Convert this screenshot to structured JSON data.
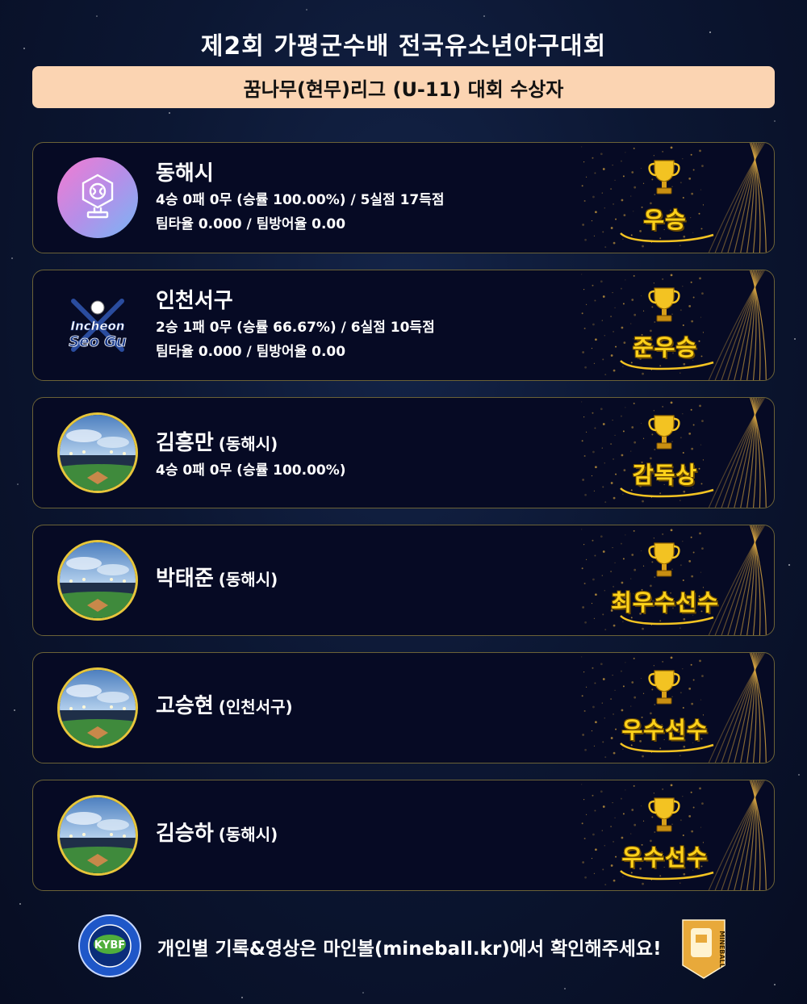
{
  "header": {
    "title": "제2회 가평군수배 전국유소년야구대회",
    "subtitle": "꿈나무(현무)리그 (U-11) 대회 수상자"
  },
  "colors": {
    "accent": "#ffd21a",
    "subtitle_bg": "#fbd4b2",
    "card_bg": "#060a24",
    "card_border": "#6b6237"
  },
  "awards": [
    {
      "name": "동해시",
      "team": "",
      "line1": "4승 0패 0무 (승률 100.00%) / 5실점 17득점",
      "line2": "팀타율 0.000 / 팀방어율 0.00",
      "award": "우승",
      "avatar": "trophy-icon"
    },
    {
      "name": "인천서구",
      "team": "",
      "line1": "2승 1패 0무 (승률 66.67%) / 6실점 10득점",
      "line2": "팀타율 0.000 / 팀방어율 0.00",
      "award": "준우승",
      "avatar": "team-logo",
      "logo_text1": "Incheon",
      "logo_text2": "Seo Gu"
    },
    {
      "name": "김흥만",
      "team": "(동해시)",
      "line1": "4승 0패 0무 (승률 100.00%)",
      "line2": "",
      "award": "감독상",
      "avatar": "stadium-photo"
    },
    {
      "name": "박태준",
      "team": "(동해시)",
      "line1": "",
      "line2": "",
      "award": "최우수선수",
      "avatar": "stadium-photo"
    },
    {
      "name": "고승현",
      "team": "(인천서구)",
      "line1": "",
      "line2": "",
      "award": "우수선수",
      "avatar": "stadium-photo"
    },
    {
      "name": "김승하",
      "team": "(동해시)",
      "line1": "",
      "line2": "",
      "award": "우수선수",
      "avatar": "stadium-photo"
    }
  ],
  "footer": {
    "text": "개인별 기록&영상은 마인볼(mineball.kr)에서 확인해주세요!",
    "left_logo_text": "KYBF",
    "right_logo_text": "MINEBALL"
  }
}
